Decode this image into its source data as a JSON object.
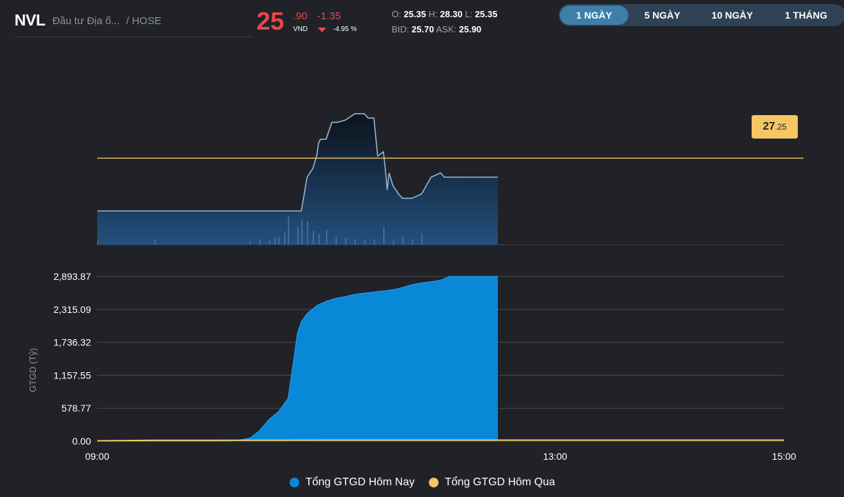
{
  "header": {
    "symbol": "NVL",
    "company": "Đầu tư Địa ố...",
    "exchange": "/ HOSE",
    "price_int": "25",
    "price_dec": ".90",
    "price_unit": "VND",
    "change": "-1.35",
    "change_pct": "-4.95 %",
    "open_label": "O:",
    "open": "25.35",
    "high_label": "H:",
    "high": "28.30",
    "low_label": "L:",
    "low": "25.35",
    "bid_label": "BID:",
    "bid": "25.70",
    "ask_label": "ASK:",
    "ask": "25.90",
    "tabs": [
      "1 NGÀY",
      "5 NGÀY",
      "10 NGÀY",
      "1 THÁNG"
    ],
    "active_tab": "1 NGÀY"
  },
  "colors": {
    "background": "#202227",
    "down": "#e5484d",
    "price_line": "#8fb8dd",
    "today_fill": "#0a88d8",
    "yesterday": "#f5c663",
    "reference": "#f5c663"
  },
  "reference_badge": {
    "int": "27",
    "dec": ".25",
    "value": 27.25
  },
  "chart_data": [
    {
      "type": "line",
      "reference_line": 27.25,
      "ylim": [
        25.2,
        29.2
      ],
      "series": [
        {
          "x": [
            "09:00",
            "09:05",
            "09:10",
            "09:15",
            "09:20",
            "09:25",
            "09:30",
            "09:35",
            "09:40",
            "09:45",
            "09:50",
            "09:55",
            "10:00",
            "10:05",
            "10:10",
            "10:15",
            "10:20",
            "10:25",
            "10:30",
            "10:35",
            "10:40",
            "10:45",
            "10:46",
            "10:47",
            "10:50",
            "10:53",
            "10:55",
            "10:56",
            "10:57",
            "11:00",
            "11:03",
            "11:06",
            "11:10",
            "11:15",
            "11:20",
            "11:22",
            "11:25",
            "11:27",
            "11:30",
            "11:31",
            "11:32",
            "11:33",
            "11:35",
            "11:38",
            "11:40",
            "11:45",
            "11:50",
            "11:55",
            "12:00",
            "12:02",
            "12:03",
            "12:05",
            "12:10",
            "12:15",
            "12:20",
            "12:25",
            "12:30"
          ],
          "values": [
            26.0,
            26.0,
            26.0,
            26.0,
            26.0,
            26.0,
            26.0,
            26.0,
            26.0,
            26.0,
            26.0,
            26.0,
            26.0,
            26.0,
            26.0,
            26.0,
            26.0,
            26.0,
            26.0,
            26.0,
            26.0,
            26.0,
            26.0,
            26.0,
            26.8,
            27.0,
            27.3,
            27.6,
            27.7,
            27.7,
            28.1,
            28.1,
            28.15,
            28.3,
            28.3,
            28.2,
            28.2,
            27.3,
            27.4,
            27.0,
            26.5,
            26.9,
            26.6,
            26.4,
            26.3,
            26.3,
            26.4,
            26.8,
            26.9,
            26.8,
            26.8,
            26.8,
            26.8,
            26.8,
            26.8,
            26.8,
            26.8
          ]
        }
      ],
      "volume_bars": {
        "x": [
          "09:00",
          "09:30",
          "10:20",
          "10:25",
          "10:30",
          "10:33",
          "10:35",
          "10:38",
          "10:40",
          "10:45",
          "10:47",
          "10:50",
          "10:53",
          "10:56",
          "11:00",
          "11:05",
          "11:10",
          "11:15",
          "11:20",
          "11:25",
          "11:30",
          "11:35",
          "11:40",
          "11:45",
          "11:50"
        ],
        "values": [
          0.06,
          0.08,
          0.05,
          0.08,
          0.06,
          0.1,
          0.12,
          0.18,
          0.42,
          0.26,
          0.36,
          0.34,
          0.2,
          0.16,
          0.22,
          0.12,
          0.1,
          0.08,
          0.06,
          0.08,
          0.26,
          0.06,
          0.12,
          0.08,
          0.16
        ]
      }
    },
    {
      "type": "area",
      "ylabel": "GTGD (Tỷ)",
      "y_ticks": [
        "0.00",
        "578.77",
        "1,157.55",
        "1,736.32",
        "2,315.09",
        "2,893.87"
      ],
      "ylim": [
        0,
        2893.87
      ],
      "x_ticks": [
        "09:00",
        "13:00",
        "15:00"
      ],
      "legend_position": "bottom",
      "series": [
        {
          "name": "Tổng GTGD Hôm Nay",
          "x": [
            "09:00",
            "09:30",
            "10:00",
            "10:10",
            "10:15",
            "10:20",
            "10:25",
            "10:30",
            "10:35",
            "10:40",
            "10:45",
            "10:47",
            "10:50",
            "10:55",
            "11:00",
            "11:05",
            "11:10",
            "11:15",
            "11:20",
            "11:25",
            "11:30",
            "11:35",
            "11:40",
            "11:45",
            "11:50",
            "11:55",
            "12:00",
            "12:05",
            "12:10",
            "12:15",
            "12:20",
            "12:25",
            "12:30"
          ],
          "values": [
            0,
            0,
            0,
            5,
            20,
            55,
            180,
            380,
            520,
            750,
            1900,
            2100,
            2240,
            2380,
            2460,
            2510,
            2540,
            2580,
            2600,
            2620,
            2640,
            2660,
            2700,
            2750,
            2780,
            2800,
            2830,
            2893.87,
            2893.87,
            2893.87,
            2893.87,
            2893.87,
            2893.87
          ]
        },
        {
          "name": "Tổng GTGD Hôm Qua",
          "x": [
            "09:00",
            "09:30",
            "10:00",
            "10:30",
            "11:00",
            "11:30",
            "12:00",
            "12:30",
            "13:00",
            "13:30",
            "14:00",
            "14:30",
            "15:00"
          ],
          "values": [
            0,
            8,
            10,
            11,
            12,
            12,
            12,
            12,
            12,
            12,
            12,
            12,
            12
          ]
        }
      ]
    }
  ],
  "legend": [
    {
      "label": "Tổng GTGD Hôm Nay",
      "color": "#0a88d8"
    },
    {
      "label": "Tổng GTGD Hôm Qua",
      "color": "#f5c663"
    }
  ]
}
